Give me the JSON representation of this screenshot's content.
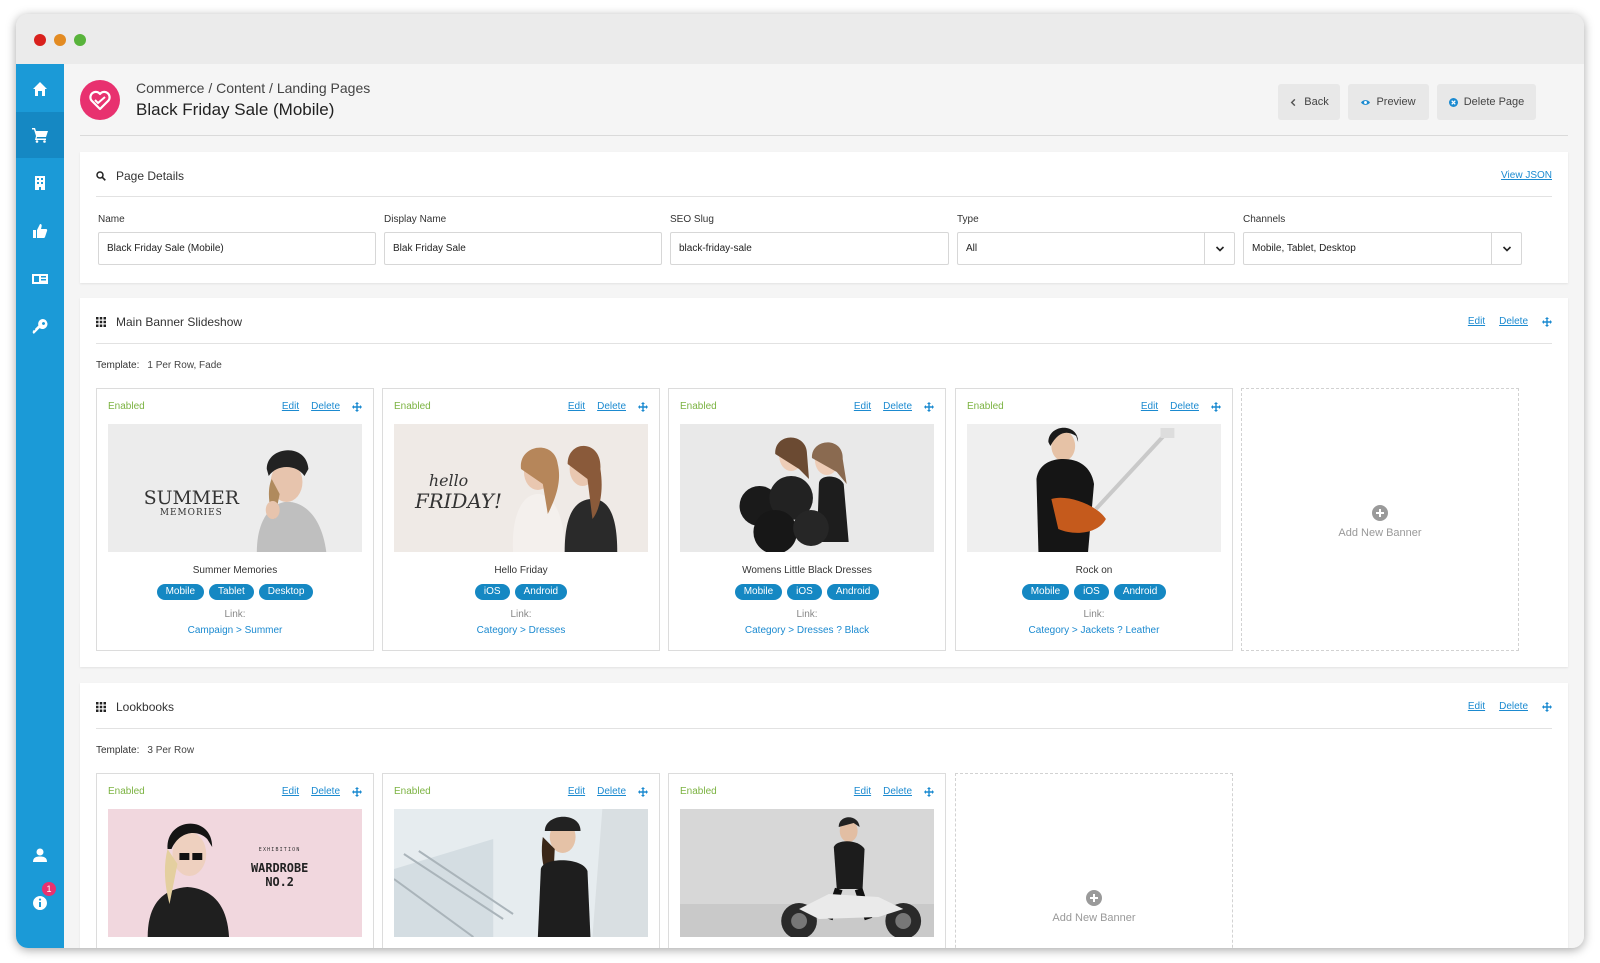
{
  "app": {
    "breadcrumb": "Commerce / Content / Landing Pages",
    "title": "Black Friday Sale (Mobile)",
    "buttons": {
      "back": "Back",
      "preview": "Preview",
      "delete_page": "Delete Page"
    },
    "notification_count": "1",
    "accent": "#1b9ad7",
    "brand": "#e8316f"
  },
  "page_details": {
    "title": "Page Details",
    "view_json": "View JSON",
    "fields": [
      {
        "label": "Name",
        "value": "Black Friday Sale (Mobile)"
      },
      {
        "label": "Display Name",
        "value": "Blak Friday Sale"
      },
      {
        "label": "SEO Slug",
        "value": "black-friday-sale"
      },
      {
        "label": "Type",
        "value": "All"
      },
      {
        "label": "Channels",
        "value": "Mobile, Tablet, Desktop"
      }
    ]
  },
  "section_actions": {
    "edit": "Edit",
    "delete": "Delete"
  },
  "main_banner": {
    "title": "Main Banner Slideshow",
    "template_label": "Template:",
    "template_value": "1 Per Row, Fade",
    "banners": [
      {
        "status": "Enabled",
        "name": "Summer Memories",
        "chips": [
          "Mobile",
          "Tablet",
          "Desktop"
        ],
        "link_label": "Link:",
        "link": "Campaign > Summer",
        "image_text": "SUMMER",
        "image_text2": "MEMORIES"
      },
      {
        "status": "Enabled",
        "name": "Hello Friday",
        "chips": [
          "iOS",
          "Android"
        ],
        "link_label": "Link:",
        "link": "Category > Dresses",
        "image_text": "hello",
        "image_text2": "FRIDAY!"
      },
      {
        "status": "Enabled",
        "name": "Womens Little Black Dresses",
        "chips": [
          "Mobile",
          "iOS",
          "Android"
        ],
        "link_label": "Link:",
        "link": "Category > Dresses ? Black"
      },
      {
        "status": "Enabled",
        "name": "Rock on",
        "chips": [
          "Mobile",
          "iOS",
          "Android"
        ],
        "link_label": "Link:",
        "link": "Category > Jackets ? Leather"
      }
    ],
    "add_new": "Add New Banner"
  },
  "lookbooks": {
    "title": "Lookbooks",
    "template_label": "Template:",
    "template_value": "3 Per Row",
    "banners": [
      {
        "status": "Enabled",
        "image_text_small": "EXHIBITION",
        "image_text": "WARDROBE",
        "image_text2": "NO.2"
      },
      {
        "status": "Enabled"
      },
      {
        "status": "Enabled"
      }
    ],
    "add_new": "Add New Banner"
  },
  "icons": {
    "sidebar": [
      "home-icon",
      "cart-icon",
      "building-icon",
      "thumbs-up-icon",
      "id-card-icon",
      "key-icon",
      "user-icon",
      "info-icon"
    ]
  }
}
